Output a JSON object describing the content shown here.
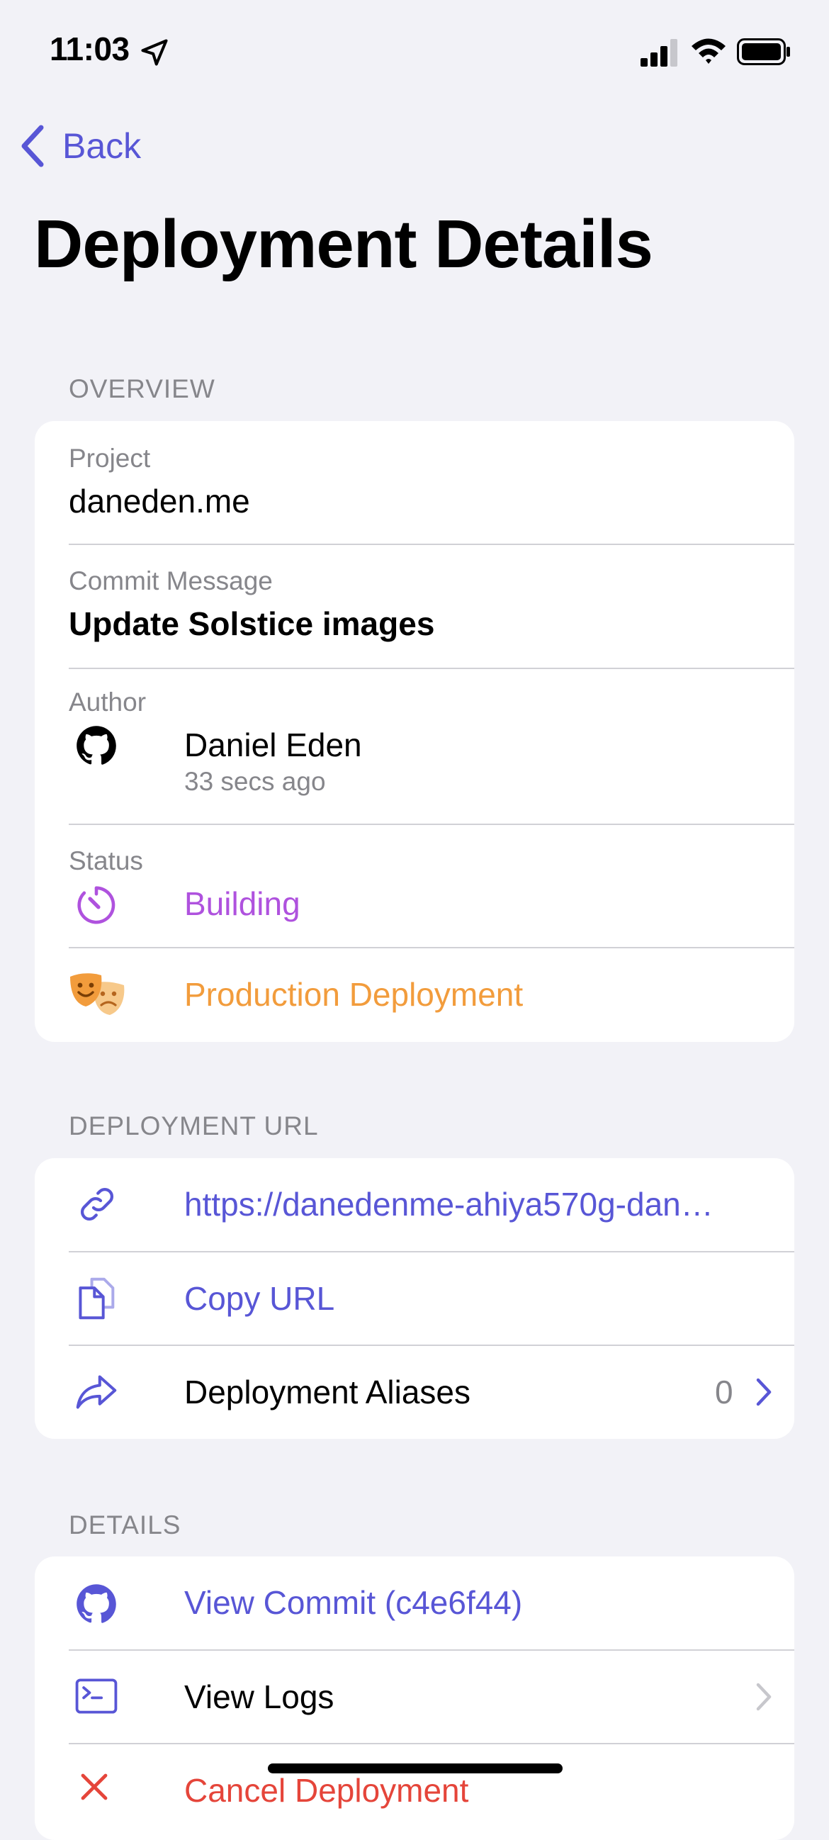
{
  "status_bar": {
    "time": "11:03"
  },
  "nav": {
    "back_label": "Back"
  },
  "page_title": "Deployment Details",
  "overview": {
    "header": "OVERVIEW",
    "project_label": "Project",
    "project_value": "daneden.me",
    "commit_label": "Commit Message",
    "commit_value": "Update Solstice images",
    "author_label": "Author",
    "author_name": "Daniel Eden",
    "author_time": "33 secs ago",
    "status_label": "Status",
    "status_value": "Building",
    "environment": "Production Deployment"
  },
  "deployment_url": {
    "header": "DEPLOYMENT URL",
    "url": "https://danedenme-ahiya570g-dan…",
    "copy_label": "Copy URL",
    "aliases_label": "Deployment Aliases",
    "aliases_count": "0"
  },
  "details": {
    "header": "DETAILS",
    "view_commit": "View Commit (c4e6f44)",
    "view_logs": "View Logs",
    "cancel": "Cancel Deployment"
  },
  "colors": {
    "accent": "#5856D6",
    "building": "#AF52DE",
    "production": "#F29C3C",
    "danger": "#E5453A",
    "secondary_text": "#86868B",
    "background": "#F2F2F7"
  },
  "icons": {
    "location": "location-arrow-icon",
    "signal": "cellular-signal-icon",
    "wifi": "wifi-icon",
    "battery": "battery-icon",
    "back": "chevron-left-icon",
    "author": "github-icon",
    "status": "timer-icon",
    "environment": "theater-masks-icon",
    "url": "link-icon",
    "copy": "document-copy-icon",
    "aliases": "share-arrow-icon",
    "commit": "github-icon",
    "logs": "terminal-icon",
    "cancel": "x-mark-icon",
    "disclosure": "chevron-right-icon"
  }
}
